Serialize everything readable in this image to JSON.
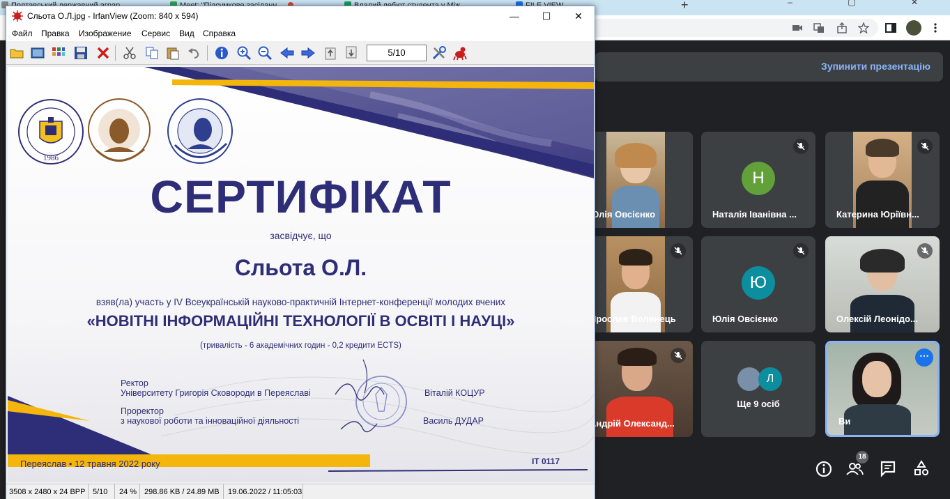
{
  "chrome": {
    "tabs": [
      {
        "label": "Полтавський державний аграр..."
      },
      {
        "label": "Meet: \"Підсумкове засіданн..."
      },
      {
        "label": "Вдалий дебют студента у Між..."
      },
      {
        "label": "FILE VIEW"
      }
    ],
    "new_tab": "+",
    "window_controls": "–  ▢  ✕"
  },
  "meet": {
    "stop_presenting": "Зупинити презентацію",
    "participants": [
      {
        "name": "Юлія Овсієнко",
        "kind": "video",
        "muted": false
      },
      {
        "name": "Наталія Іванівна ...",
        "kind": "avatar",
        "initial": "Н",
        "color": "#62a139",
        "muted": true
      },
      {
        "name": "Катерина Юріївн...",
        "kind": "video",
        "muted": true
      },
      {
        "name": "Ярослав Волинець",
        "kind": "video",
        "muted": true
      },
      {
        "name": "Юлія Овсієнко",
        "kind": "avatar",
        "initial": "Ю",
        "color": "#0d8e9e",
        "muted": true
      },
      {
        "name": "Олексій Леонідо...",
        "kind": "video",
        "muted": true
      },
      {
        "name": "Андрій Олександ...",
        "kind": "video",
        "muted": true
      },
      {
        "name": "Ще 9 осіб",
        "kind": "group",
        "initial": "Л",
        "color": "#0d8e9e",
        "muted": false
      },
      {
        "name": "Ви",
        "kind": "self",
        "muted": false
      }
    ],
    "people_count": "18",
    "more_icon": "⋯"
  },
  "irfanview": {
    "title": "Сльота О.Л.jpg - IrfanView (Zoom: 840 x 594)",
    "window_buttons": {
      "min": "—",
      "max": "☐",
      "close": "✕"
    },
    "menu": [
      "Файл",
      "Правка",
      "Изображение",
      "Сервис",
      "Вид",
      "Справка"
    ],
    "page_indicator": "5/10",
    "status": {
      "dimensions": "3508 x 2480 x 24 BPP",
      "page": "5/10",
      "zoom": "24 %",
      "size": "298.86 KB / 24.89 MB",
      "datetime": "19.06.2022 / 11:05:03"
    }
  },
  "certificate": {
    "title": "СЕРТИФІКАТ",
    "witness": "засвідчує, що",
    "name": "Сльота О.Л.",
    "participation": "взяв(ла) участь у IV Всеукраїнській науково-практичній Інтернет-конференції молодих вчених",
    "conference": "«НОВІТНІ ІНФОРМАЦІЙНІ ТЕХНОЛОГІЇ В ОСВІТІ І НАУЦІ»",
    "duration": "(тривалість - 6 академічних годин - 0,2 кредити ECTS)",
    "rector_title": "Ректор",
    "rector_org": "Університету Григорія Сковороди в Переяславі",
    "rector_name": "Віталій КОЦУР",
    "prorector_title": "Проректор",
    "prorector_org": "з наукової роботи та інноваційної діяльності",
    "prorector_name": "Василь ДУДАР",
    "footer": "Переяслав • 12 травня 2022 року",
    "number": "IT  0117",
    "logo1_year": "1986",
    "colors": {
      "navy": "#2e2d77",
      "gold": "#f4b60c"
    }
  }
}
